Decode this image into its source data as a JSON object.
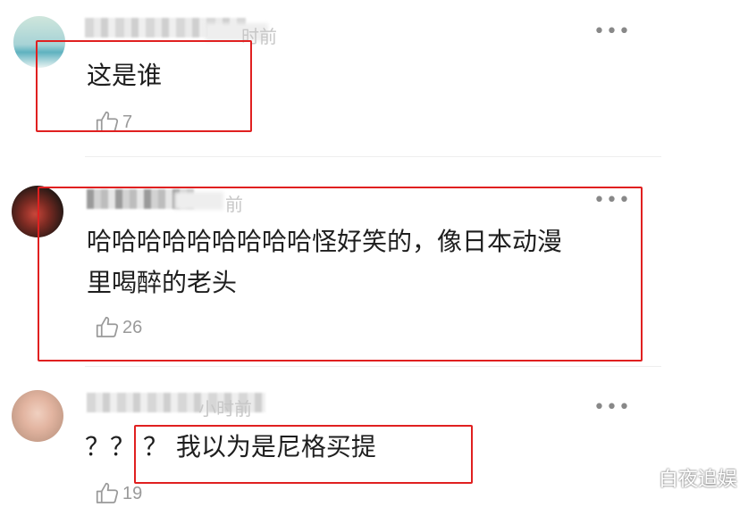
{
  "comments": [
    {
      "time_suffix": "时前",
      "text": "这是谁",
      "likes": "7"
    },
    {
      "time_suffix": "前",
      "text_line1": "哈哈哈哈哈哈哈哈哈怪好笑的，像日本动漫",
      "text_line2": "里喝醉的老头",
      "likes": "26"
    },
    {
      "time_suffix": "小时前",
      "text_prefix": "？？",
      "text": "？ 我以为是尼格买提",
      "likes": "19"
    }
  ],
  "more_label": "•••",
  "watermark": "白夜追娱",
  "colors": {
    "highlight_box": "#e02020",
    "meta_text": "#c7c7c7"
  },
  "icons": {
    "like": "thumbs-up-icon",
    "more": "more-dots-icon"
  }
}
